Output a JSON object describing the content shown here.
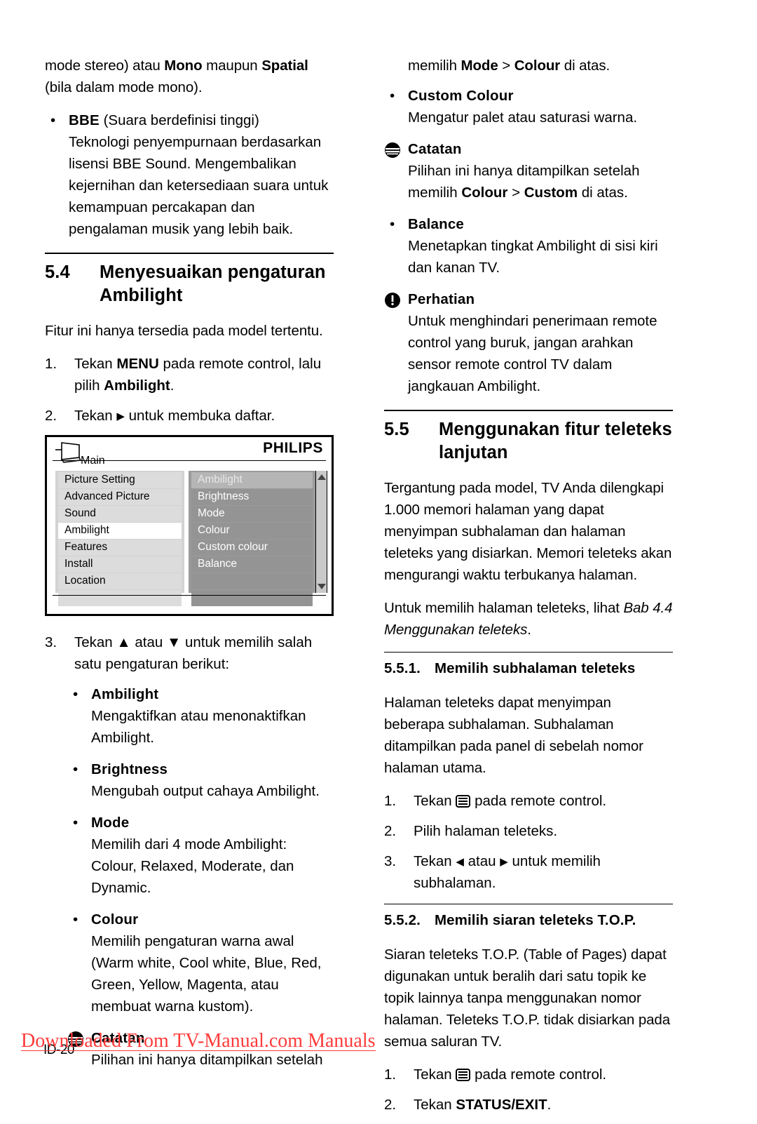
{
  "page": {
    "number": "ID-20",
    "watermark": "Downloaded From TV-Manual.com Manuals"
  },
  "left_column": {
    "cont_para": {
      "pre": "mode stereo) atau ",
      "b1": "Mono",
      "mid": " maupun ",
      "b2": "Spatial",
      "post": " (bila dalam mode mono)."
    },
    "bbe": {
      "bullet": "•",
      "title": "BBE",
      "title_rest": " (Suara berdefinisi tinggi)",
      "body": "Teknologi penyempurnaan berdasarkan lisensi BBE Sound. Mengembalikan kejernihan dan ketersediaan suara untuk kemampuan percakapan dan pengalaman musik yang lebih baik."
    },
    "section": {
      "number": "5.4",
      "title": "Menyesuaikan pengaturan Ambilight"
    },
    "intro": "Fitur ini hanya tersedia pada model tertentu.",
    "steps": [
      {
        "num": "1.",
        "pre": "Tekan ",
        "bold": "MENU",
        "mid": " pada remote control, lalu pilih ",
        "bold2": "Ambilight",
        "post": "."
      },
      {
        "num": "2.",
        "pre": "Tekan ",
        "icon": "right-arrow-icon",
        "post": " untuk membuka daftar."
      }
    ],
    "osd": {
      "brand": "PHILIPS",
      "main_label": "Main",
      "tv_icon": "tv-icon",
      "left_items": [
        "Picture Setting",
        "Advanced Picture",
        "Sound",
        "Ambilight",
        "Features",
        "Install",
        "Location"
      ],
      "left_selected": "Ambilight",
      "right_items": [
        "Ambilight",
        "Brightness",
        "Mode",
        "Colour",
        "Custom colour",
        "Balance"
      ],
      "right_selected": "Ambilight",
      "scroll_up_icon": "scroll-up-arrow-icon",
      "scroll_down_icon": "scroll-down-arrow-icon"
    },
    "step3": {
      "num": "3.",
      "pre": "Tekan ",
      "icon_up": "up-arrow-icon",
      "mid": " atau ",
      "icon_down": "down-arrow-icon",
      "post": " untuk memilih salah satu pengaturan berikut:"
    },
    "settings": [
      {
        "title": "Ambilight",
        "body": "Mengaktifkan atau menonaktifkan Ambilight."
      },
      {
        "title": "Brightness",
        "body": "Mengubah output cahaya Ambilight."
      },
      {
        "title": "Mode",
        "body": "Memilih dari 4 mode Ambilight: Colour, Relaxed, Moderate, dan Dynamic."
      },
      {
        "title": "Colour",
        "body": "Memilih pengaturan warna awal (Warm white, Cool white, Blue, Red, Green, Yellow, Magenta, atau membuat warna kustom)."
      }
    ],
    "note": {
      "icon": "note-icon",
      "title": "Catatan",
      "body": "Pilihan ini hanya ditampilkan setelah"
    }
  },
  "right_column": {
    "note_cont": {
      "pre": "memilih ",
      "b1": "Mode",
      "mid": " > ",
      "b2": "Colour",
      "post": " di atas."
    },
    "custom_colour": {
      "title": "Custom Colour",
      "body": "Mengatur palet atau saturasi warna."
    },
    "note": {
      "icon": "note-icon",
      "title": "Catatan",
      "body_pre": "Pilihan ini hanya ditampilkan setelah memilih ",
      "b1": "Colour",
      "body_mid": " > ",
      "b2": "Custom",
      "body_post": " di atas."
    },
    "balance": {
      "title": "Balance",
      "body": "Menetapkan tingkat Ambilight di sisi kiri dan kanan TV."
    },
    "caution": {
      "icon": "caution-icon",
      "title": "Perhatian",
      "body": "Untuk menghindari penerimaan remote control yang buruk, jangan arahkan sensor remote control TV dalam jangkauan Ambilight."
    },
    "section": {
      "number": "5.5",
      "title": "Menggunakan fitur teleteks lanjutan"
    },
    "para1": "Tergantung pada model, TV Anda dilengkapi 1.000 memori halaman yang dapat menyimpan subhalaman dan halaman teleteks yang disiarkan. Memori teleteks akan mengurangi waktu terbukanya halaman.",
    "para2": {
      "pre": "Untuk memilih halaman teleteks, lihat ",
      "italic": "Bab 4.4 Menggunakan teleteks",
      "post": "."
    },
    "sub1": {
      "number": "5.5.1.",
      "title": "Memilih subhalaman teleteks",
      "body": "Halaman teleteks dapat menyimpan beberapa subhalaman. Subhalaman ditampilkan pada panel di sebelah nomor halaman utama.",
      "steps": [
        {
          "num": "1.",
          "pre": "Tekan ",
          "icon": "teletext-icon",
          "post": " pada remote control."
        },
        {
          "num": "2.",
          "pre": "Pilih halaman teleteks.",
          "icon": "",
          "post": ""
        },
        {
          "num": "3.",
          "pre": "Tekan ",
          "icon_left": "left-arrow-icon",
          "mid": " atau ",
          "icon_right": "right-arrow-icon",
          "post": " untuk memilih subhalaman."
        }
      ]
    },
    "sub2": {
      "number": "5.5.2.",
      "title": "Memilih siaran teleteks T.O.P.",
      "body": "Siaran teleteks T.O.P. (Table of Pages) dapat digunakan untuk beralih dari satu topik ke topik lainnya tanpa menggunakan nomor halaman. Teleteks T.O.P. tidak disiarkan pada semua saluran TV.",
      "steps": [
        {
          "num": "1.",
          "pre": "Tekan ",
          "icon": "teletext-icon",
          "post": " pada remote control."
        },
        {
          "num": "2.",
          "pre": "Tekan ",
          "bold": "STATUS/EXIT",
          "post": "."
        }
      ]
    }
  }
}
